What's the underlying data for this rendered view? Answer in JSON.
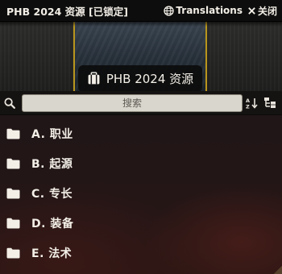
{
  "window": {
    "title": "PHB 2024 资源 [已锁定]",
    "translations_label": "Translations",
    "close_label": "关闭"
  },
  "banner": {
    "title": "PHB 2024 资源"
  },
  "search": {
    "placeholder": "搜索",
    "value": ""
  },
  "folders": [
    {
      "label": "A. 职业",
      "icon": "folder-icon"
    },
    {
      "label": "B. 起源",
      "icon": "folder-icon"
    },
    {
      "label": "C. 专长",
      "icon": "folder-icon"
    },
    {
      "label": "D. 装备",
      "icon": "folder-icon"
    },
    {
      "label": "E. 法术",
      "icon": "folder-icon"
    }
  ],
  "colors": {
    "accent_gold": "#b8951d",
    "titlebar_bg": "#0d0d0d",
    "text_light": "#f3efe7",
    "search_bg": "#d9d6cd"
  }
}
